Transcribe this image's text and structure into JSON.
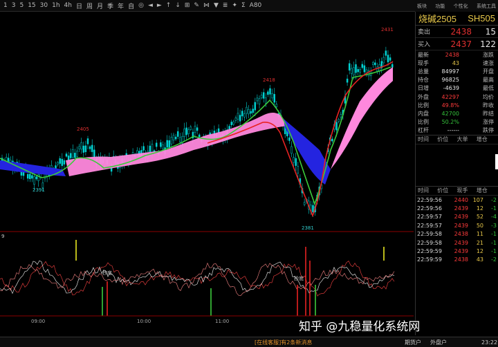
{
  "toolbar": [
    "1",
    "3",
    "5",
    "15",
    "30",
    "1h",
    "4h",
    "日",
    "周",
    "月",
    "季",
    "年",
    "自",
    "◎",
    "◄",
    "►",
    "↑",
    "↓",
    "⊞",
    "✎",
    "⋈",
    "▼",
    "≣",
    "✦",
    "Σ",
    "A80"
  ],
  "topright": [
    "板块",
    "功能",
    "个性化",
    "系统工具"
  ],
  "chart": {
    "price_labels": {
      "p2431": "2431",
      "p2418": "2418",
      "p2405": "2405",
      "p2391": "2391",
      "p2381": "2381"
    },
    "sub_label": "9",
    "buy_marks": [
      "抄底",
      "抄底"
    ],
    "time_labels": [
      "09:00",
      "10:00",
      "11:00"
    ],
    "colors": {
      "up": "#00d2d2",
      "down": "#00d2d2",
      "ma_red": "#e82222",
      "ma_green": "#3ccc3c",
      "band_pink": "#ff88dd",
      "band_blue": "#2424e0"
    }
  },
  "panel": {
    "name": "烧碱2505",
    "code": "SH505",
    "sell": {
      "label": "卖出",
      "price": "2438",
      "vol": "15"
    },
    "buy": {
      "label": "买入",
      "price": "2437",
      "vol": "122"
    },
    "stats": [
      {
        "a": "最新",
        "b": "2438",
        "bc": "red",
        "c": "涨跌"
      },
      {
        "a": "现手",
        "b": "43",
        "bc": "yel",
        "c": "速涨"
      },
      {
        "a": "总量",
        "b": "84997",
        "bc": "wht",
        "c": "开盘"
      },
      {
        "a": "持仓",
        "b": "96825",
        "bc": "wht",
        "c": "最高"
      },
      {
        "a": "日增",
        "b": "-4639",
        "bc": "wht",
        "c": "最低"
      },
      {
        "a": "外盘",
        "b": "42297",
        "bc": "red",
        "c": "均价"
      },
      {
        "a": "比例",
        "b": "49.8%",
        "bc": "red",
        "c": "昨收"
      },
      {
        "a": "内盘",
        "b": "42700",
        "bc": "grn",
        "c": "昨结"
      },
      {
        "a": "比例",
        "b": "50.2%",
        "bc": "grn",
        "c": "涨停"
      },
      {
        "a": "杠杆",
        "b": "------",
        "bc": "wht",
        "c": "跌停"
      }
    ],
    "mid_headers": [
      "时间",
      "价位",
      "大单",
      "增仓"
    ],
    "tick_headers": [
      "时间",
      "价位",
      "现手",
      "增仓"
    ],
    "ticks": [
      {
        "t": "22:59:56",
        "p": "2440",
        "pc": "red",
        "v": "107",
        "c": "-2"
      },
      {
        "t": "22:59:56",
        "p": "2439",
        "pc": "red",
        "v": "12",
        "c": "-1"
      },
      {
        "t": "22:59:57",
        "p": "2439",
        "pc": "red",
        "v": "52",
        "c": "-4"
      },
      {
        "t": "22:59:57",
        "p": "2439",
        "pc": "red",
        "v": "50",
        "c": "-3"
      },
      {
        "t": "22:59:58",
        "p": "2438",
        "pc": "red",
        "v": "11",
        "c": "-1"
      },
      {
        "t": "22:59:58",
        "p": "2439",
        "pc": "red",
        "v": "21",
        "c": "-1"
      },
      {
        "t": "22:59:59",
        "p": "2439",
        "pc": "red",
        "v": "12",
        "c": "-1"
      },
      {
        "t": "22:59:59",
        "p": "2438",
        "pc": "red",
        "v": "43",
        "c": "-2"
      }
    ]
  },
  "status": {
    "message": "[在线客服]有2条新消息",
    "btn1": "期货户",
    "btn2": "外盘户",
    "time": "23:22"
  },
  "watermark": "知乎 @九稳量化系统网"
}
